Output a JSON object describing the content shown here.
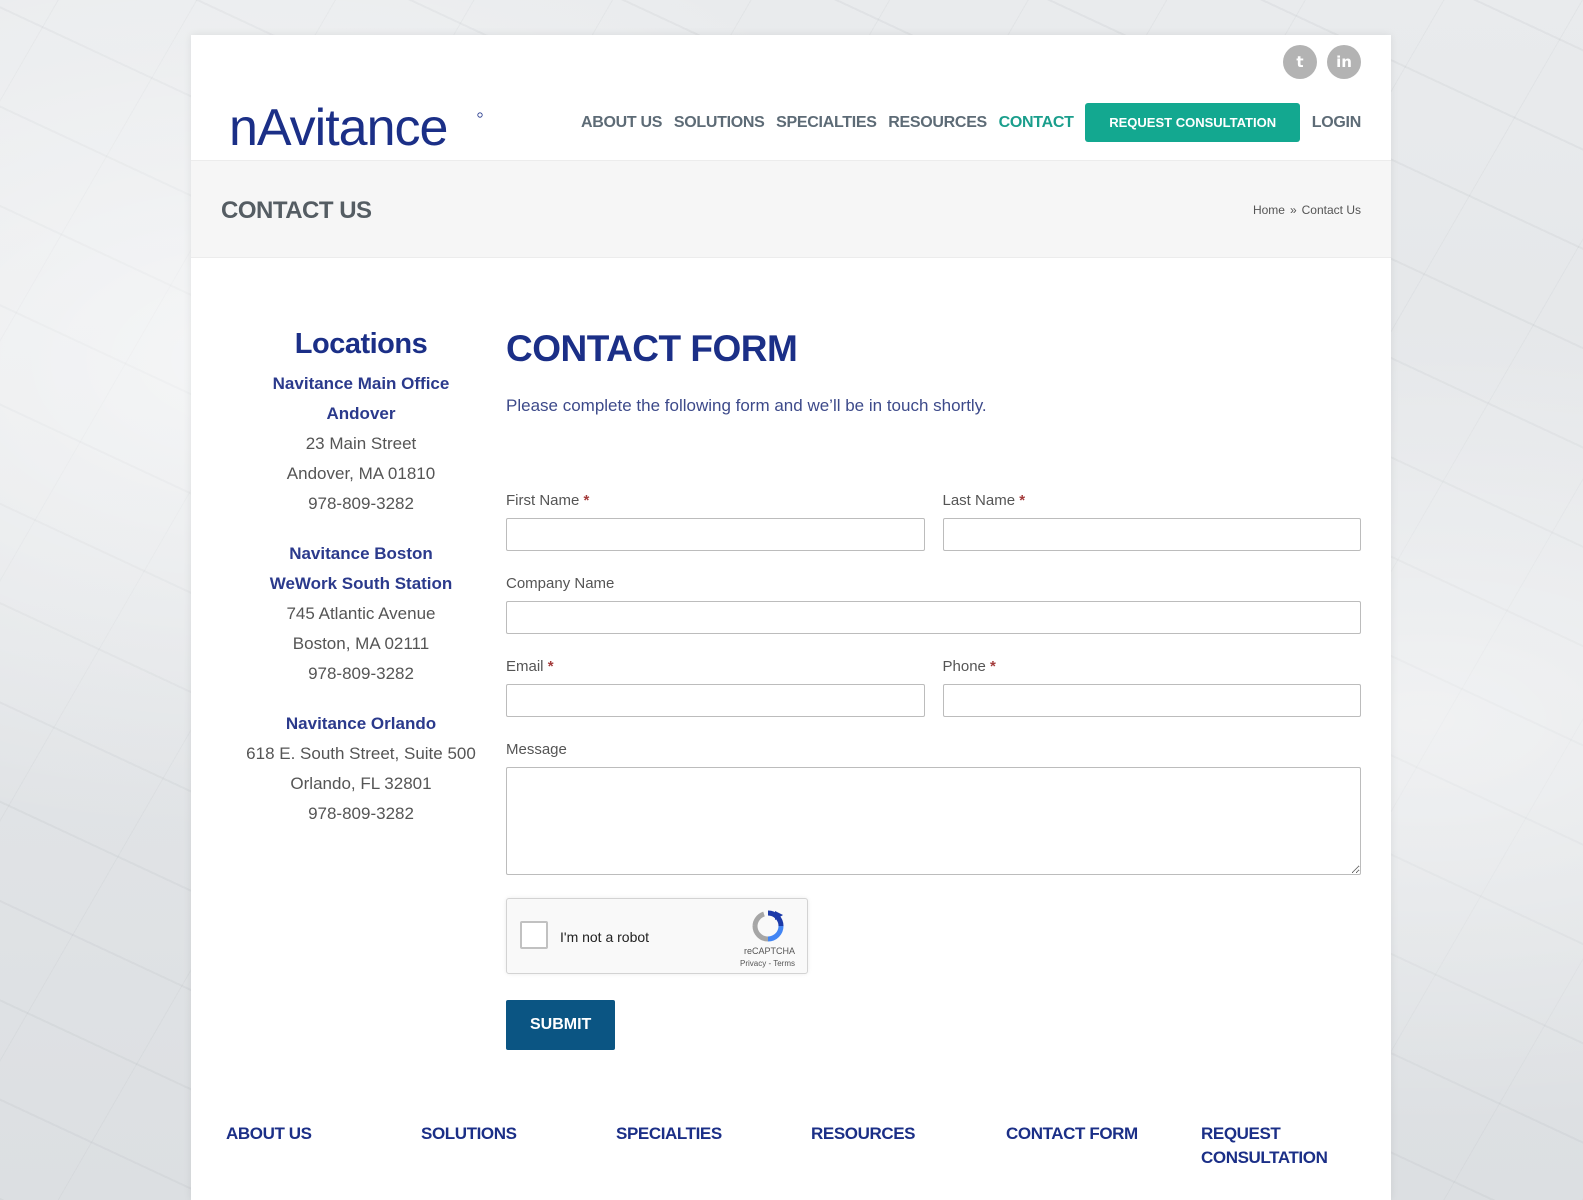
{
  "social": {
    "twitter_glyph": "t",
    "linkedin_glyph": "in"
  },
  "logo": {
    "text": "nAvitance"
  },
  "nav": {
    "items": [
      {
        "label": "ABOUT US"
      },
      {
        "label": "SOLUTIONS"
      },
      {
        "label": "SPECIALTIES"
      },
      {
        "label": "RESOURCES"
      },
      {
        "label": "CONTACT"
      }
    ],
    "cta": "REQUEST CONSULTATION",
    "login": "LOGIN",
    "active_color": "#1a9e8c",
    "cta_color": "#13a890"
  },
  "titlebar": {
    "title": "CONTACT US",
    "breadcrumb": {
      "home": "Home",
      "sep": "»",
      "current": "Contact Us"
    }
  },
  "locations": {
    "heading": "Locations",
    "offices": [
      {
        "name1": "Navitance Main Office",
        "name2": "Andover",
        "street": "23 Main Street",
        "city": "Andover, MA 01810",
        "phone": "978-809-3282"
      },
      {
        "name1": "Navitance Boston",
        "name2": "WeWork South Station",
        "street": "745 Atlantic Avenue",
        "city": "Boston, MA 02111",
        "phone": "978-809-3282"
      },
      {
        "name1": "Navitance Orlando",
        "street": "618 E. South Street, Suite 500",
        "city": "Orlando, FL 32801",
        "phone": "978-809-3282"
      }
    ]
  },
  "form": {
    "title": "CONTACT FORM",
    "intro": "Please complete the following form and we’ll be in touch shortly.",
    "required_mark": "*",
    "labels": {
      "first_name": "First Name",
      "last_name": "Last Name",
      "company": "Company Name",
      "email": "Email",
      "phone": "Phone",
      "message": "Message"
    },
    "captcha": {
      "label": "I'm not a robot",
      "brand": "reCAPTCHA",
      "links": "Privacy - Terms"
    },
    "submit": "SUBMIT"
  },
  "footer": {
    "columns": [
      "ABOUT US",
      "SOLUTIONS",
      "SPECIALTIES",
      "RESOURCES",
      "CONTACT FORM",
      "REQUEST CONSULTATION"
    ]
  }
}
